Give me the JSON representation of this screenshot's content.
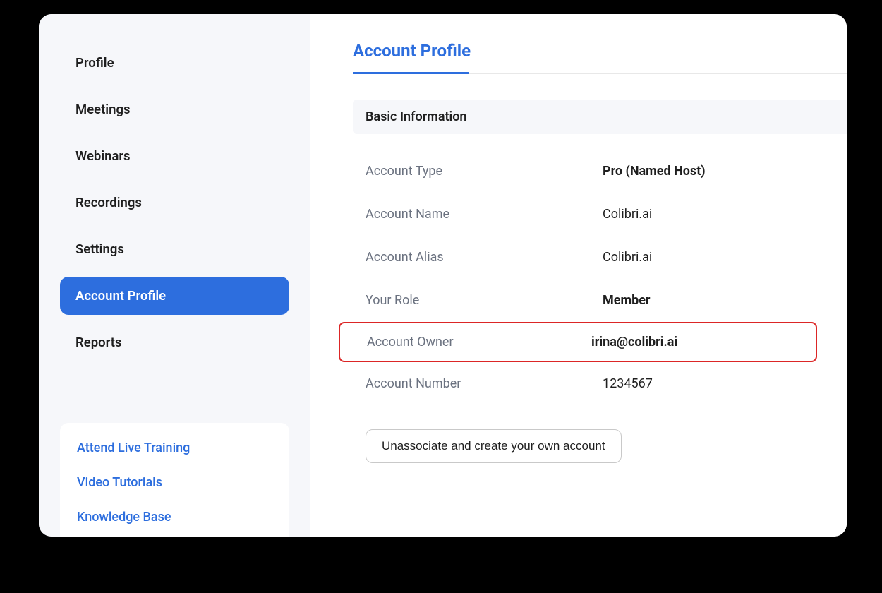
{
  "sidebar": {
    "nav_items": [
      {
        "label": "Profile",
        "active": false
      },
      {
        "label": "Meetings",
        "active": false
      },
      {
        "label": "Webinars",
        "active": false
      },
      {
        "label": "Recordings",
        "active": false
      },
      {
        "label": "Settings",
        "active": false
      },
      {
        "label": "Account Profile",
        "active": true
      },
      {
        "label": "Reports",
        "active": false
      }
    ],
    "help_links": [
      {
        "label": "Attend Live Training"
      },
      {
        "label": "Video Tutorials"
      },
      {
        "label": "Knowledge Base"
      }
    ]
  },
  "main": {
    "page_title": "Account Profile",
    "section_header": "Basic Information",
    "rows": {
      "account_type": {
        "label": "Account Type",
        "value": "Pro (Named Host)",
        "bold": true
      },
      "account_name": {
        "label": "Account Name",
        "value": "Colibri.ai",
        "bold": false
      },
      "account_alias": {
        "label": "Account Alias",
        "value": "Colibri.ai",
        "bold": false
      },
      "your_role": {
        "label": "Your Role",
        "value": "Member",
        "bold": true
      },
      "account_owner": {
        "label": "Account Owner",
        "value": "irina@colibri.ai",
        "bold": true,
        "highlighted": true
      },
      "account_number": {
        "label": "Account Number",
        "value": "1234567",
        "bold": false
      }
    },
    "action_button": "Unassociate and create your own account"
  }
}
